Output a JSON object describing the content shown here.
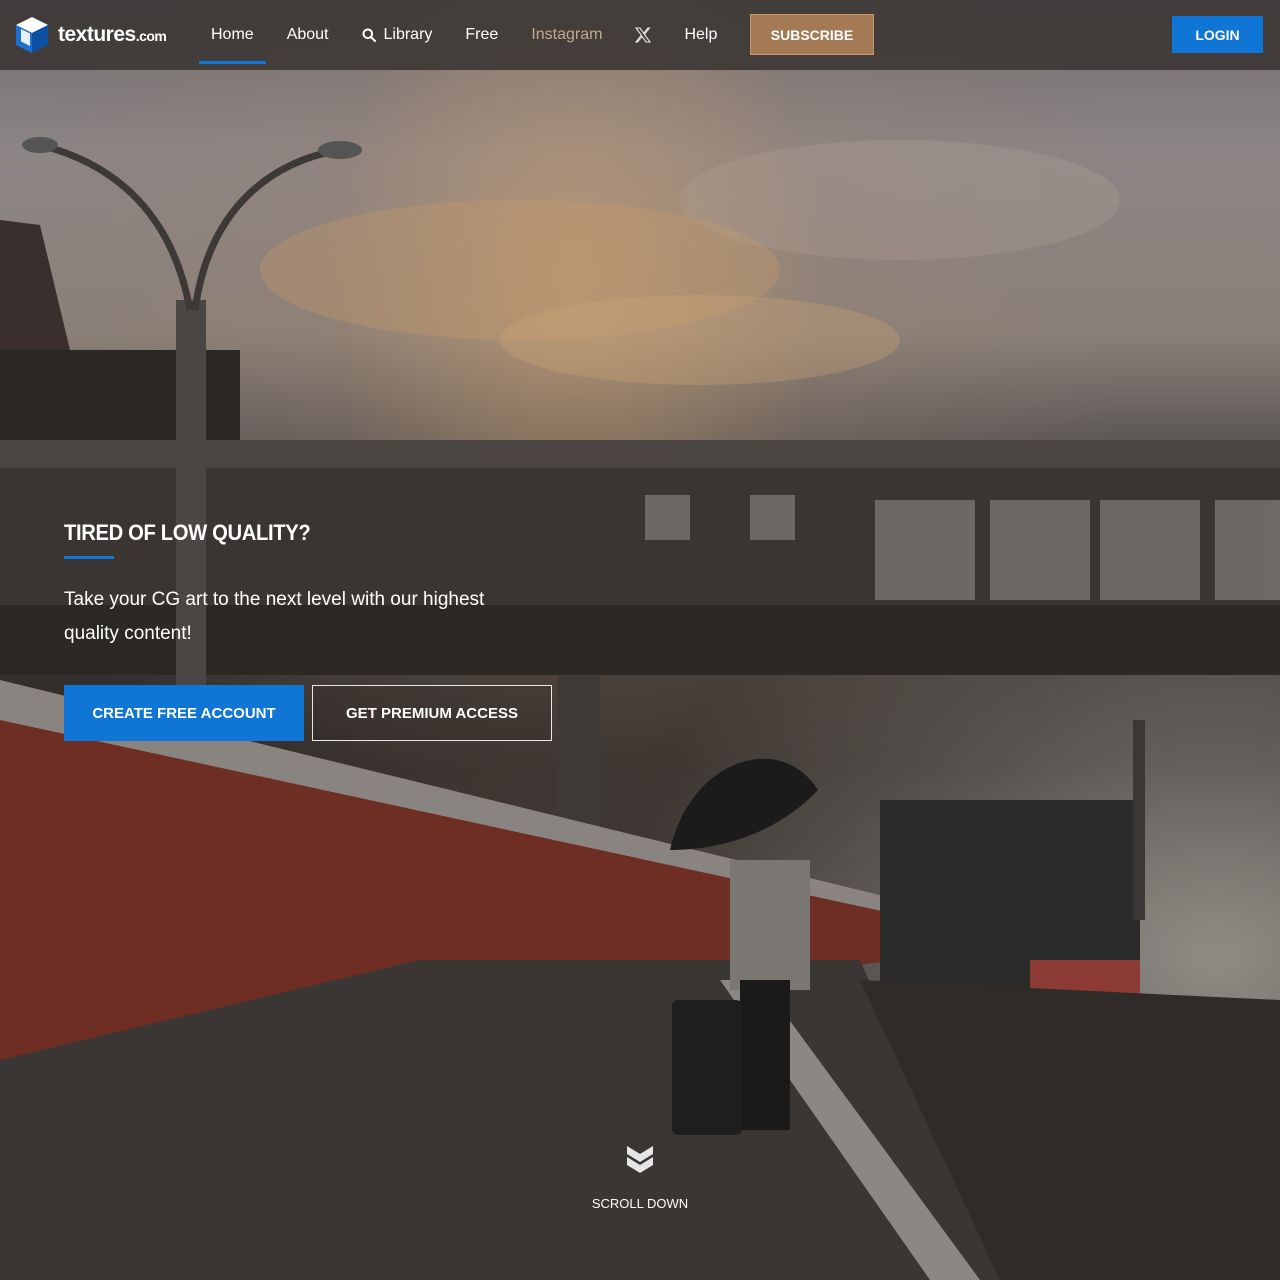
{
  "brand": {
    "name": "textures",
    "tld": ".com",
    "logo_icon": "cube-logo-icon",
    "accent_color": "#0f76d6",
    "subscribe_color": "#a47a55"
  },
  "nav": {
    "items": [
      {
        "label": "Home",
        "active": true
      },
      {
        "label": "About"
      },
      {
        "label": "Library",
        "icon": "search-icon"
      },
      {
        "label": "Free"
      },
      {
        "label": "Instagram"
      },
      {
        "label": "",
        "icon": "x-icon"
      },
      {
        "label": "Help"
      }
    ],
    "subscribe_label": "SUBSCRIBE",
    "login_label": "LOGIN"
  },
  "hero": {
    "title": "TIRED OF LOW QUALITY?",
    "text": "Take your CG art to the next level with our highest quality content!",
    "primary_cta": "CREATE FREE ACCOUNT",
    "secondary_cta": "GET PREMIUM ACCESS",
    "scroll_label": "SCROLL DOWN",
    "scroll_icon": "chevron-double-down-icon"
  }
}
